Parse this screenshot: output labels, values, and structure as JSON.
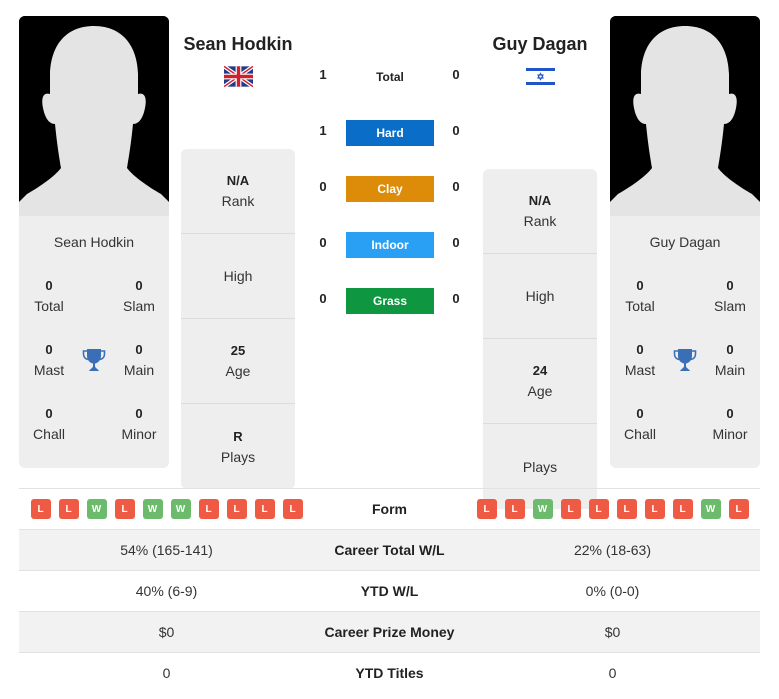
{
  "players": {
    "left": {
      "name": "Sean Hodkin",
      "country_flag": "united-kingdom-flag",
      "card_name": "Sean Hodkin",
      "titles": {
        "total": {
          "value": "0",
          "label": "Total"
        },
        "slam": {
          "value": "0",
          "label": "Slam"
        },
        "mast": {
          "value": "0",
          "label": "Mast"
        },
        "main": {
          "value": "0",
          "label": "Main"
        },
        "chall": {
          "value": "0",
          "label": "Chall"
        },
        "minor": {
          "value": "0",
          "label": "Minor"
        }
      },
      "info": {
        "rank": {
          "value": "N/A",
          "label": "Rank"
        },
        "high": {
          "value": "",
          "label": "High"
        },
        "age": {
          "value": "25",
          "label": "Age"
        },
        "plays": {
          "value": "R",
          "label": "Plays"
        }
      }
    },
    "right": {
      "name": "Guy Dagan",
      "country_flag": "israel-flag",
      "card_name": "Guy Dagan",
      "titles": {
        "total": {
          "value": "0",
          "label": "Total"
        },
        "slam": {
          "value": "0",
          "label": "Slam"
        },
        "mast": {
          "value": "0",
          "label": "Mast"
        },
        "main": {
          "value": "0",
          "label": "Main"
        },
        "chall": {
          "value": "0",
          "label": "Chall"
        },
        "minor": {
          "value": "0",
          "label": "Minor"
        }
      },
      "info": {
        "rank": {
          "value": "N/A",
          "label": "Rank"
        },
        "high": {
          "value": "",
          "label": "High"
        },
        "age": {
          "value": "24",
          "label": "Age"
        },
        "plays": {
          "value": "",
          "label": "Plays"
        }
      }
    }
  },
  "h2h": {
    "total": {
      "label": "Total",
      "left": "1",
      "right": "0"
    },
    "surfaces": [
      {
        "label": "Hard",
        "left": "1",
        "right": "0",
        "color": "#0a6ec8"
      },
      {
        "label": "Clay",
        "left": "0",
        "right": "0",
        "color": "#dd8c0a"
      },
      {
        "label": "Indoor",
        "left": "0",
        "right": "0",
        "color": "#2aa0f5"
      },
      {
        "label": "Grass",
        "left": "0",
        "right": "0",
        "color": "#0e9640"
      }
    ]
  },
  "comparison": {
    "form": {
      "label": "Form",
      "left": [
        "L",
        "L",
        "W",
        "L",
        "W",
        "W",
        "L",
        "L",
        "L",
        "L"
      ],
      "right": [
        "L",
        "L",
        "W",
        "L",
        "L",
        "L",
        "L",
        "L",
        "W",
        "L"
      ]
    },
    "rows": [
      {
        "label": "Career Total W/L",
        "left": "54% (165-141)",
        "right": "22% (18-63)"
      },
      {
        "label": "YTD W/L",
        "left": "40% (6-9)",
        "right": "0% (0-0)"
      },
      {
        "label": "Career Prize Money",
        "left": "$0",
        "right": "$0"
      },
      {
        "label": "YTD Titles",
        "left": "0",
        "right": "0"
      }
    ]
  },
  "colors": {
    "loss": "#ee5a44",
    "win": "#6cba6c",
    "trophy": "#3a6fb8"
  }
}
